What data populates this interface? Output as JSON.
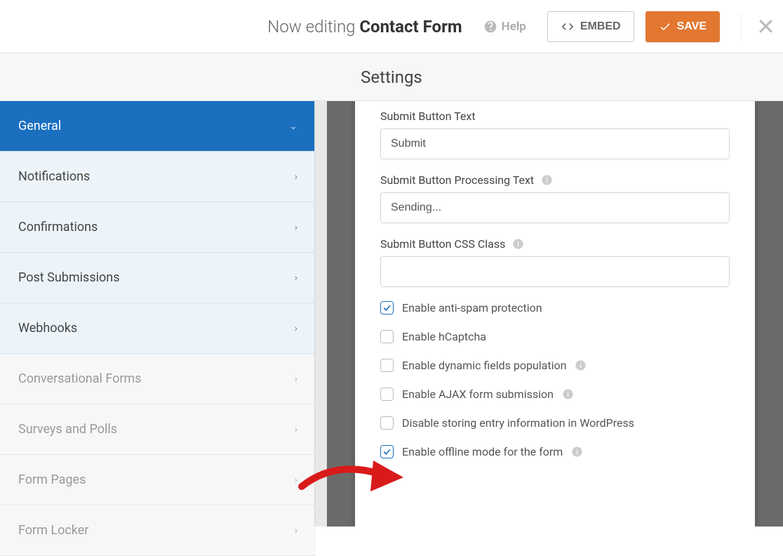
{
  "header": {
    "editing_prefix": "Now editing ",
    "form_name": "Contact Form",
    "help_label": "Help",
    "embed_label": "EMBED",
    "save_label": "SAVE"
  },
  "page_title": "Settings",
  "sidebar": {
    "items": [
      {
        "label": "General",
        "active": true
      },
      {
        "label": "Notifications"
      },
      {
        "label": "Confirmations"
      },
      {
        "label": "Post Submissions"
      },
      {
        "label": "Webhooks"
      },
      {
        "label": "Conversational Forms",
        "muted": true
      },
      {
        "label": "Surveys and Polls",
        "muted": true
      },
      {
        "label": "Form Pages",
        "muted": true
      },
      {
        "label": "Form Locker",
        "muted": true
      }
    ]
  },
  "form": {
    "submit_button_text_label": "Submit Button Text",
    "submit_button_text": "Submit",
    "submit_processing_label": "Submit Button Processing Text",
    "submit_processing_text": "Sending...",
    "submit_css_label": "Submit Button CSS Class",
    "submit_css_value": "",
    "checkboxes": [
      {
        "label": "Enable anti-spam protection",
        "checked": true,
        "info": false
      },
      {
        "label": "Enable hCaptcha",
        "checked": false,
        "info": false
      },
      {
        "label": "Enable dynamic fields population",
        "checked": false,
        "info": true
      },
      {
        "label": "Enable AJAX form submission",
        "checked": false,
        "info": true
      },
      {
        "label": "Disable storing entry information in WordPress",
        "checked": false,
        "info": false
      },
      {
        "label": "Enable offline mode for the form",
        "checked": true,
        "info": true
      }
    ]
  }
}
